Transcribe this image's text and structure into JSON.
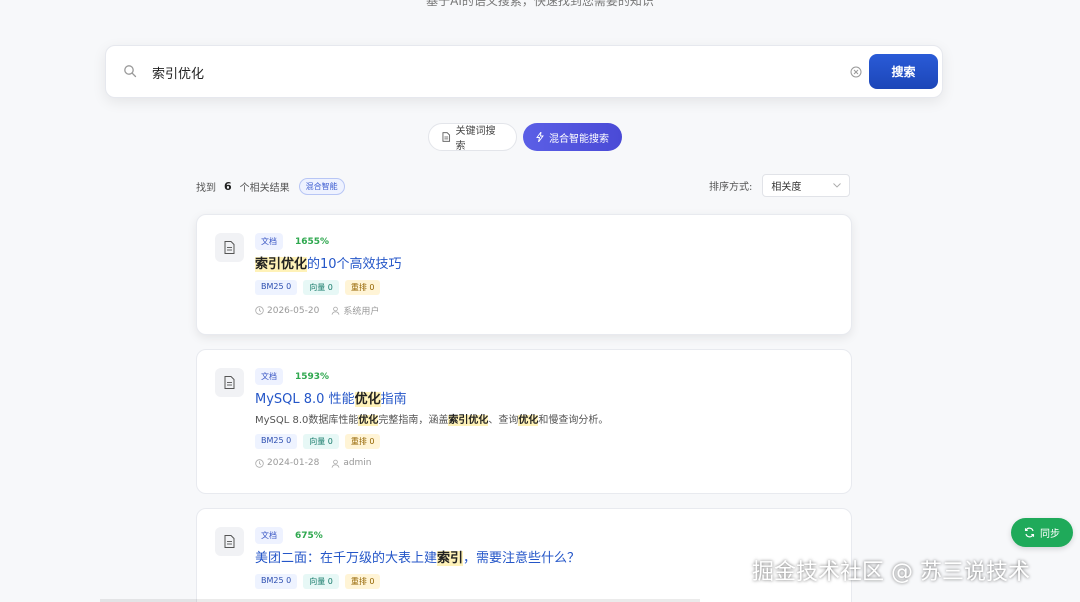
{
  "subtitle": "基于AI的语义搜索，快速找到您需要的知识",
  "search": {
    "value": "索引优化",
    "button_label": "搜索"
  },
  "mode_tabs": [
    {
      "label": "关键词搜索",
      "active": false
    },
    {
      "label": "混合智能搜索",
      "active": true
    }
  ],
  "results_summary": {
    "prefix": "找到",
    "count": "6",
    "suffix": "个相关结果",
    "mode_badge": "混合智能"
  },
  "sort": {
    "label": "排序方式:",
    "selected": "相关度"
  },
  "results": [
    {
      "type": "文档",
      "score": "1655%",
      "title_parts": [
        {
          "text": "索引优化",
          "hl": true
        },
        {
          "text": "的10个高效技巧",
          "hl": false
        }
      ],
      "desc_parts": [],
      "tags": {
        "bm25": "BM25 0",
        "vector": "向量 0",
        "rerank": "重排 0"
      },
      "date": "2026-05-20",
      "author": "系统用户"
    },
    {
      "type": "文档",
      "score": "1593%",
      "title_parts": [
        {
          "text": "MySQL 8.0 性能",
          "hl": false
        },
        {
          "text": "优化",
          "hl": true
        },
        {
          "text": "指南",
          "hl": false
        }
      ],
      "desc_parts": [
        {
          "text": "MySQL 8.0数据库性能",
          "hl": false
        },
        {
          "text": "优化",
          "hl": true
        },
        {
          "text": "完整指南，涵盖",
          "hl": false
        },
        {
          "text": "索引优化",
          "hl": true
        },
        {
          "text": "、查询",
          "hl": false
        },
        {
          "text": "优化",
          "hl": true
        },
        {
          "text": "和慢查询分析。",
          "hl": false
        }
      ],
      "tags": {
        "bm25": "BM25 0",
        "vector": "向量 0",
        "rerank": "重排 0"
      },
      "date": "2024-01-28",
      "author": "admin"
    },
    {
      "type": "文档",
      "score": "675%",
      "title_parts": [
        {
          "text": "美团二面：在千万级的大表上建",
          "hl": false
        },
        {
          "text": "索引",
          "hl": true
        },
        {
          "text": "，需要注意些什么？",
          "hl": false
        }
      ],
      "desc_parts": [],
      "tags": {
        "bm25": "BM25 0",
        "vector": "向量 0",
        "rerank": "重排 0"
      },
      "date": "",
      "author": ""
    }
  ],
  "sync_button": "同步",
  "watermark": "掘金技术社区 @ 苏三说技术",
  "colors": {
    "primary": "#2456c8",
    "accent": "#5b5fe6",
    "success": "#1faa5a",
    "highlight": "#fff2b8"
  }
}
